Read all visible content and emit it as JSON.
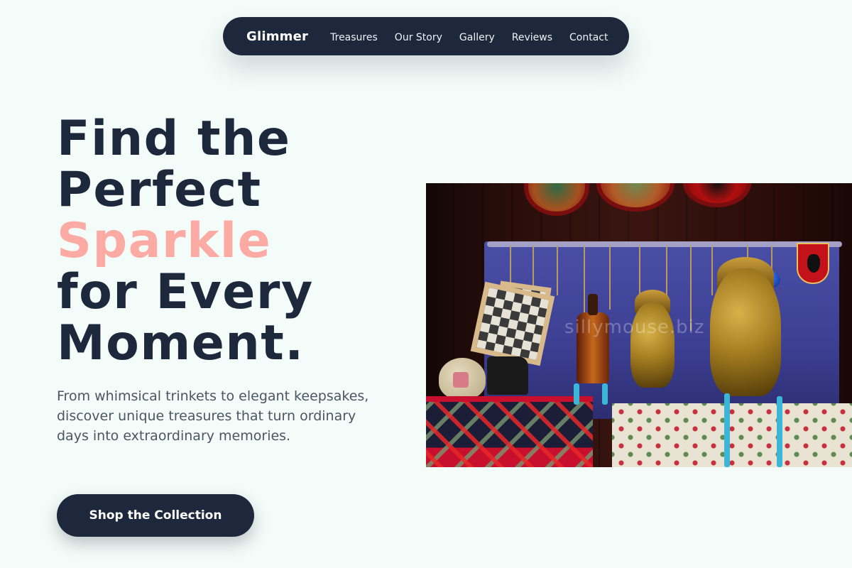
{
  "nav": {
    "brand": "Glimmer",
    "links": [
      "Treasures",
      "Our Story",
      "Gallery",
      "Reviews",
      "Contact"
    ]
  },
  "hero": {
    "title_lines": [
      "Find the",
      "Perfect",
      "Sparkle",
      "for Every",
      "Moment."
    ],
    "subtitle": "From whimsical trinkets to elegant keepsakes, discover unique treasures that turn ordinary days into extraordinary memories.",
    "cta_label": "Shop the Collection",
    "image_watermark": "sillymouse.biz"
  },
  "colors": {
    "background": "#f3fcf8",
    "navy": "#1e283c",
    "accent_pink": "#fbaaa4",
    "body_text": "#4b5563"
  }
}
